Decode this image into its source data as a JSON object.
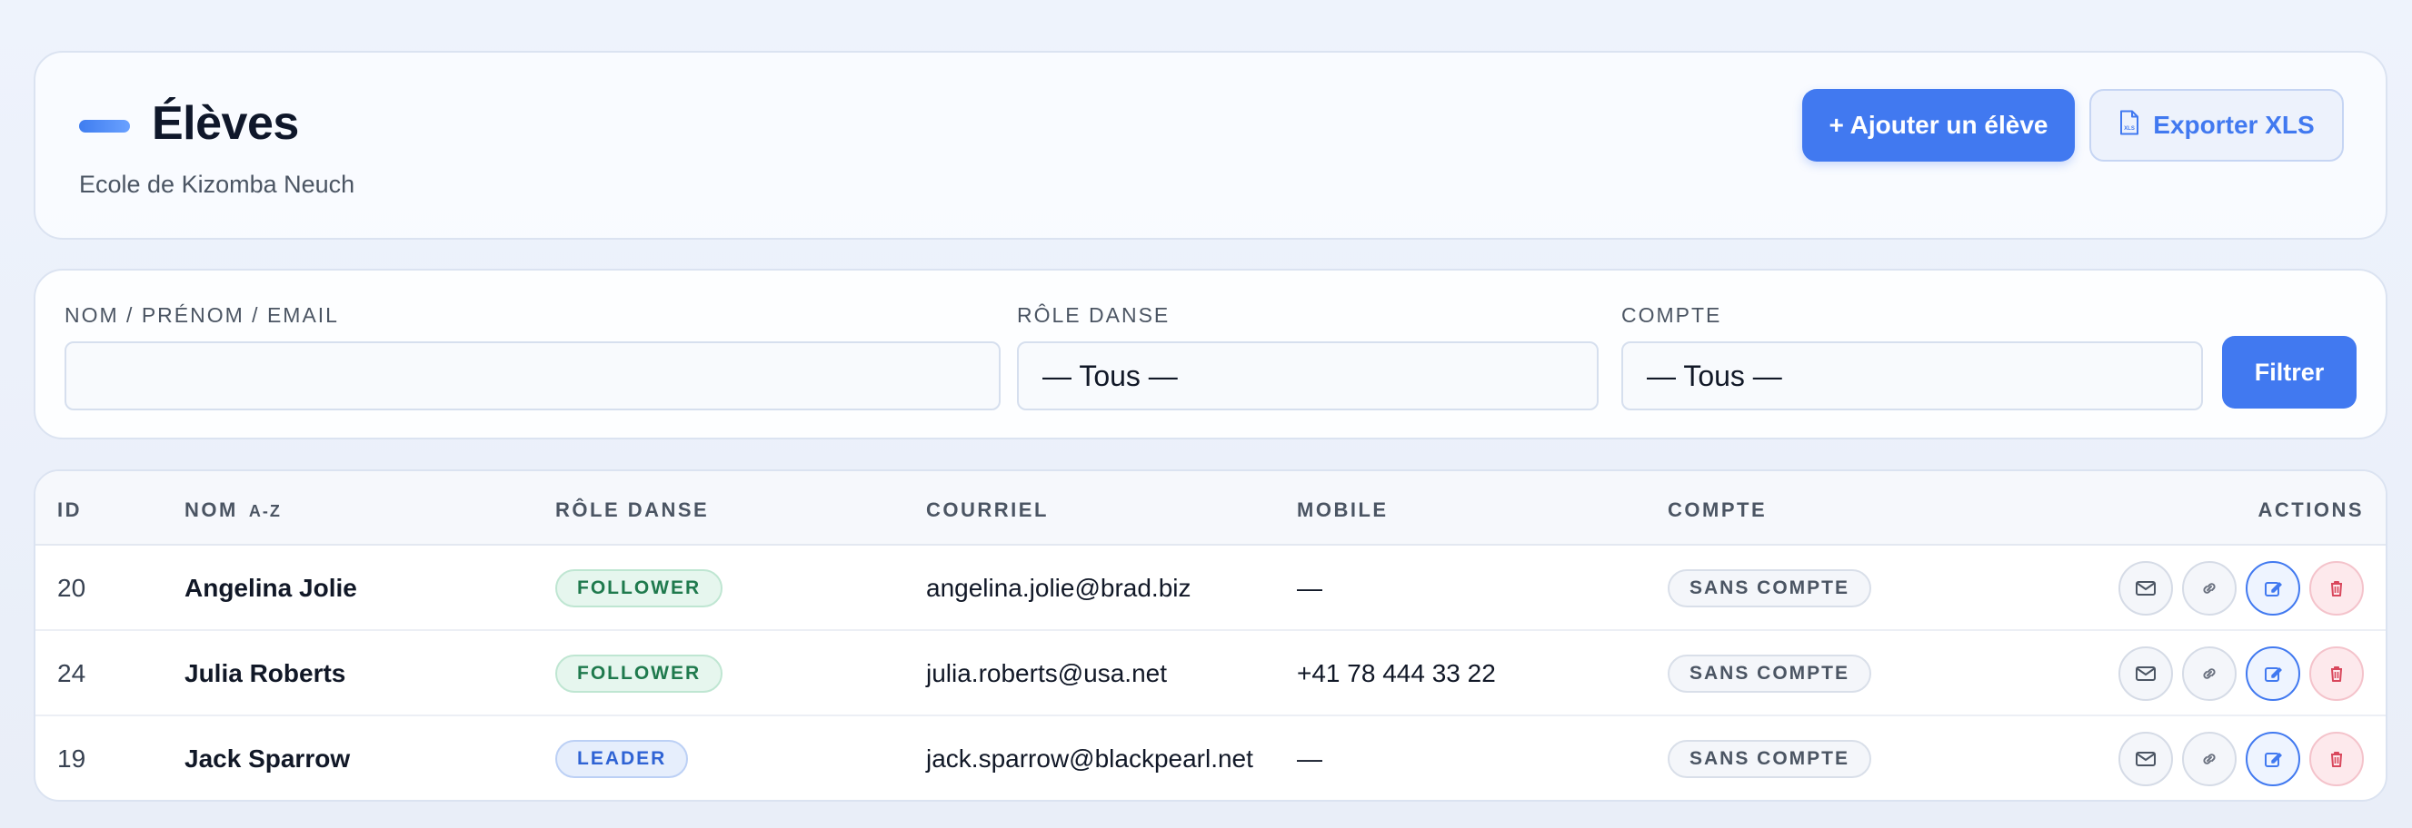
{
  "header": {
    "title": "Élèves",
    "subtitle": "Ecole de Kizomba Neuch",
    "add_label": "+ Ajouter un élève",
    "export_label": "Exporter XLS",
    "export_icon_text": "XLS"
  },
  "filters": {
    "search_label": "NOM / PRÉNOM / EMAIL",
    "search_value": "",
    "role_label": "RÔLE DANSE",
    "role_value": "— Tous —",
    "account_label": "COMPTE",
    "account_value": "— Tous —",
    "submit_label": "Filtrer"
  },
  "table": {
    "columns": {
      "id": "ID",
      "name": "NOM",
      "name_sort": "A-Z",
      "role": "RÔLE DANSE",
      "email": "COURRIEL",
      "mobile": "MOBILE",
      "account": "COMPTE",
      "actions": "ACTIONS"
    },
    "rows": [
      {
        "id": "20",
        "name": "Angelina Jolie",
        "role": "FOLLOWER",
        "email": "angelina.jolie@brad.biz",
        "mobile": "—",
        "account": "SANS COMPTE"
      },
      {
        "id": "24",
        "name": "Julia Roberts",
        "role": "FOLLOWER",
        "email": "julia.roberts@usa.net",
        "mobile": "+41 78 444 33 22",
        "account": "SANS COMPTE"
      },
      {
        "id": "19",
        "name": "Jack Sparrow",
        "role": "LEADER",
        "email": "jack.sparrow@blackpearl.net",
        "mobile": "—",
        "account": "SANS COMPTE"
      }
    ]
  },
  "colors": {
    "accent": "#4179f0",
    "follower": "#1f7a4d",
    "leader": "#2f63d4",
    "danger": "#d9475c"
  }
}
